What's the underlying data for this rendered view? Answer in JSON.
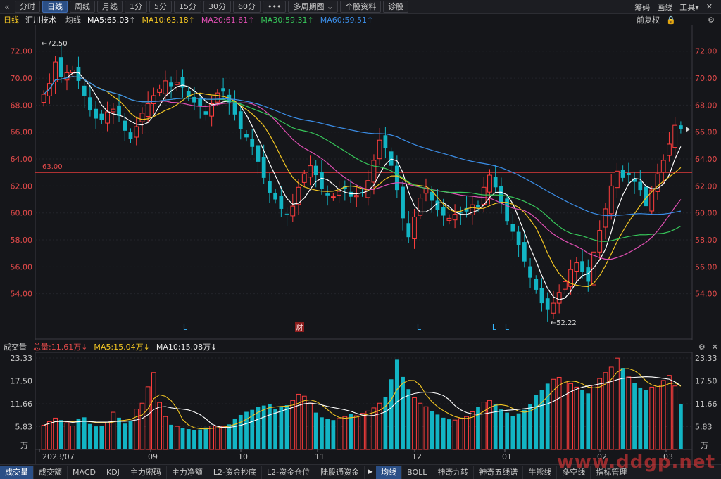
{
  "toolbar": {
    "back_icon": "«",
    "buttons": [
      "分时",
      "日线",
      "周线",
      "月线",
      "1分",
      "5分",
      "15分",
      "30分",
      "60分",
      "•••",
      "多周期图 ⌄",
      "个股资料",
      "诊股"
    ],
    "active_index": 1,
    "right_items": [
      "筹码",
      "画线",
      "工具▾"
    ],
    "close_icon": "✕"
  },
  "infobar": {
    "period": "日线",
    "stock_name": "汇川技术",
    "avg_label": "均线",
    "ma5": "MA5:65.03↑",
    "ma10": "MA10:63.18↑",
    "ma20": "MA20:61.61↑",
    "ma30": "MA30:59.31↑",
    "ma60": "MA60:59.51↑",
    "adjust": "前复权",
    "colors": {
      "ma5": "#ffffff",
      "ma10": "#f3c623",
      "ma20": "#e04fb3",
      "ma30": "#37c75a",
      "ma60": "#3b8ee8"
    }
  },
  "price_axis": {
    "ticks": [
      "72.00",
      "70.00",
      "68.00",
      "66.00",
      "64.00",
      "62.00",
      "60.00",
      "58.00",
      "56.00",
      "54.00"
    ],
    "tick_values": [
      72,
      70,
      68,
      66,
      64,
      62,
      60,
      58,
      56,
      54
    ],
    "range": [
      52.0,
      73.5
    ]
  },
  "annotations": {
    "high": "←72.50",
    "low": "←52.22",
    "ref_line_label": "63.00",
    "ref_line_value": 63.0,
    "event_markers": [
      "L",
      "财",
      "L",
      "L",
      "L"
    ]
  },
  "time_axis": {
    "labels": [
      "2023/07",
      "09",
      "10",
      "11",
      "12",
      "01",
      "02",
      "03"
    ]
  },
  "volume": {
    "title": "成交量",
    "total": "总量:11.61万↓",
    "ma5": "MA5:15.04万↓",
    "ma10": "MA10:15.08万↓",
    "ticks": [
      "23.33",
      "17.50",
      "11.66",
      "5.83"
    ],
    "tick_values": [
      23.33,
      17.5,
      11.66,
      5.83
    ],
    "unit": "万",
    "max": 23.33
  },
  "bottom_tabs_left": [
    "成交量",
    "成交额",
    "MACD",
    "KDJ",
    "主力密码",
    "主力净额",
    "L2-资金抄底",
    "L2-资金仓位",
    "陆股通资金"
  ],
  "bottom_tabs_right": [
    "均线",
    "BOLL",
    "神奇九转",
    "神奇五线谱",
    "牛熊线",
    "多空线",
    "指标管理"
  ],
  "watermark": "www.ddgp.net",
  "chart_data": {
    "type": "candlestick",
    "title": "汇川技术",
    "x_labels": [
      "2023/07",
      "09",
      "10",
      "11",
      "12",
      "01",
      "02",
      "03"
    ],
    "price_range": [
      52.0,
      73.5
    ],
    "key_prices": {
      "high": 72.5,
      "low": 52.22,
      "reference": 63.0
    },
    "closes": [
      68.8,
      69.6,
      71.2,
      70.1,
      70.4,
      70.6,
      69.8,
      68.7,
      67.6,
      67.0,
      66.9,
      67.5,
      67.7,
      67.2,
      66.1,
      65.5,
      66.4,
      67.4,
      68.1,
      68.7,
      69.2,
      69.8,
      69.4,
      69.7,
      69.3,
      68.6,
      68.2,
      67.9,
      67.3,
      68.1,
      68.9,
      69.0,
      68.2,
      67.3,
      66.2,
      65.6,
      64.9,
      63.8,
      62.6,
      61.5,
      61.0,
      60.3,
      59.9,
      60.5,
      61.9,
      62.9,
      63.5,
      62.8,
      61.8,
      61.3,
      61.2,
      61.6,
      61.8,
      61.2,
      61.3,
      61.5,
      62.4,
      63.9,
      65.4,
      64.8,
      63.5,
      61.7,
      59.6,
      58.2,
      59.7,
      61.1,
      61.8,
      60.9,
      60.2,
      59.8,
      59.6,
      59.9,
      60.0,
      60.1,
      60.6,
      60.4,
      61.9,
      62.8,
      61.9,
      60.7,
      59.4,
      58.6,
      57.6,
      56.4,
      55.2,
      54.3,
      53.3,
      52.8,
      53.3,
      54.1,
      54.9,
      55.8,
      56.3,
      55.6,
      54.9,
      57.1,
      58.7,
      60.3,
      62.0,
      63.1,
      62.6,
      62.8,
      62.3,
      61.7,
      60.5,
      61.7,
      62.9,
      63.9,
      65.1,
      66.5,
      66.2
    ],
    "volumes": [
      6.2,
      7.1,
      8.0,
      7.5,
      6.8,
      6.0,
      7.9,
      8.2,
      6.5,
      5.9,
      6.1,
      7.0,
      9.5,
      8.1,
      6.6,
      7.2,
      10.3,
      11.8,
      16.0,
      19.6,
      12.0,
      8.4,
      6.3,
      5.9,
      5.4,
      5.2,
      5.0,
      5.1,
      5.6,
      6.0,
      5.9,
      5.8,
      6.4,
      7.9,
      8.8,
      9.6,
      10.1,
      10.9,
      11.2,
      11.6,
      10.4,
      10.8,
      11.3,
      12.5,
      14.1,
      13.6,
      11.8,
      9.4,
      8.2,
      7.8,
      7.5,
      7.9,
      8.4,
      9.0,
      8.6,
      9.2,
      9.8,
      10.6,
      11.8,
      13.4,
      17.9,
      22.9,
      18.5,
      15.4,
      13.2,
      11.8,
      10.9,
      9.8,
      8.9,
      8.1,
      7.7,
      7.5,
      7.9,
      8.4,
      9.6,
      10.8,
      12.1,
      12.5,
      11.5,
      10.2,
      9.4,
      8.6,
      9.2,
      10.1,
      11.5,
      13.9,
      15.2,
      16.8,
      17.9,
      18.4,
      17.5,
      16.8,
      15.9,
      15.1,
      14.3,
      16.4,
      18.1,
      19.6,
      21.0,
      23.3,
      20.8,
      18.5,
      16.9,
      15.8,
      15.2,
      15.9,
      16.4,
      17.6,
      18.9,
      16.2,
      11.6
    ],
    "series": [
      {
        "name": "MA5",
        "color": "#ffffff",
        "last": "65.03"
      },
      {
        "name": "MA10",
        "color": "#f3c623",
        "last": "63.18"
      },
      {
        "name": "MA20",
        "color": "#e04fb3",
        "last": "61.61"
      },
      {
        "name": "MA30",
        "color": "#37c75a",
        "last": "59.31"
      },
      {
        "name": "MA60",
        "color": "#3b8ee8",
        "last": "59.51"
      }
    ]
  }
}
